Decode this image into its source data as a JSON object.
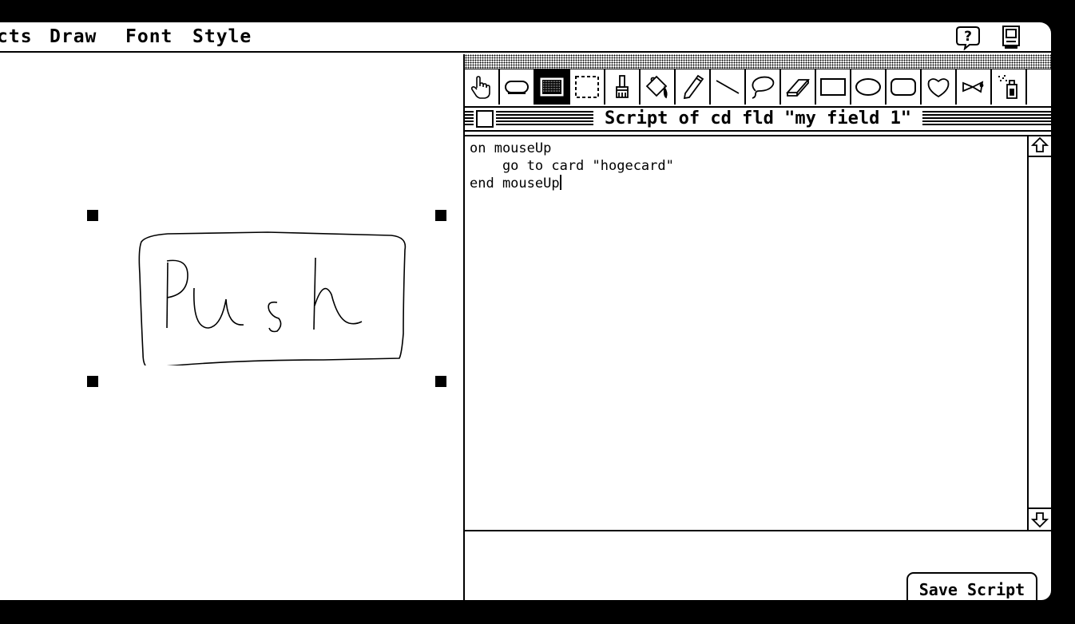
{
  "menubar": {
    "items": [
      "cts",
      "Draw",
      "Font",
      "Style"
    ],
    "help_icon": "balloon-help-icon",
    "app_icon": "application-menu-icon"
  },
  "tools_palette": {
    "tools": [
      {
        "name": "browse-tool",
        "icon": "hand-icon",
        "active": false
      },
      {
        "name": "button-tool",
        "icon": "button-icon",
        "active": false
      },
      {
        "name": "field-tool",
        "icon": "field-icon",
        "active": true
      },
      {
        "name": "select-tool",
        "icon": "select-marquee-icon",
        "active": false
      },
      {
        "name": "brush-tool",
        "icon": "brush-icon",
        "active": false
      },
      {
        "name": "bucket-tool",
        "icon": "paint-bucket-icon",
        "active": false
      },
      {
        "name": "pencil-tool",
        "icon": "pencil-icon",
        "active": false
      },
      {
        "name": "line-tool",
        "icon": "line-icon",
        "active": false
      },
      {
        "name": "lasso-tool",
        "icon": "lasso-icon",
        "active": false
      },
      {
        "name": "eraser-tool",
        "icon": "eraser-icon",
        "active": false
      },
      {
        "name": "rectangle-tool",
        "icon": "rectangle-icon",
        "active": false
      },
      {
        "name": "oval-tool",
        "icon": "oval-icon",
        "active": false
      },
      {
        "name": "round-rect-tool",
        "icon": "round-rectangle-icon",
        "active": false
      },
      {
        "name": "curve-tool",
        "icon": "curve-icon",
        "active": false
      },
      {
        "name": "polygon-tool",
        "icon": "polygon-icon",
        "active": false
      },
      {
        "name": "spray-tool",
        "icon": "spray-can-icon",
        "active": false
      }
    ]
  },
  "script_window": {
    "title": "Script of cd fld \"my field 1\"",
    "script_text": "on mouseUp\n    go to card \"hogecard\"\nend mouseUp",
    "save_label": "Save Script"
  }
}
